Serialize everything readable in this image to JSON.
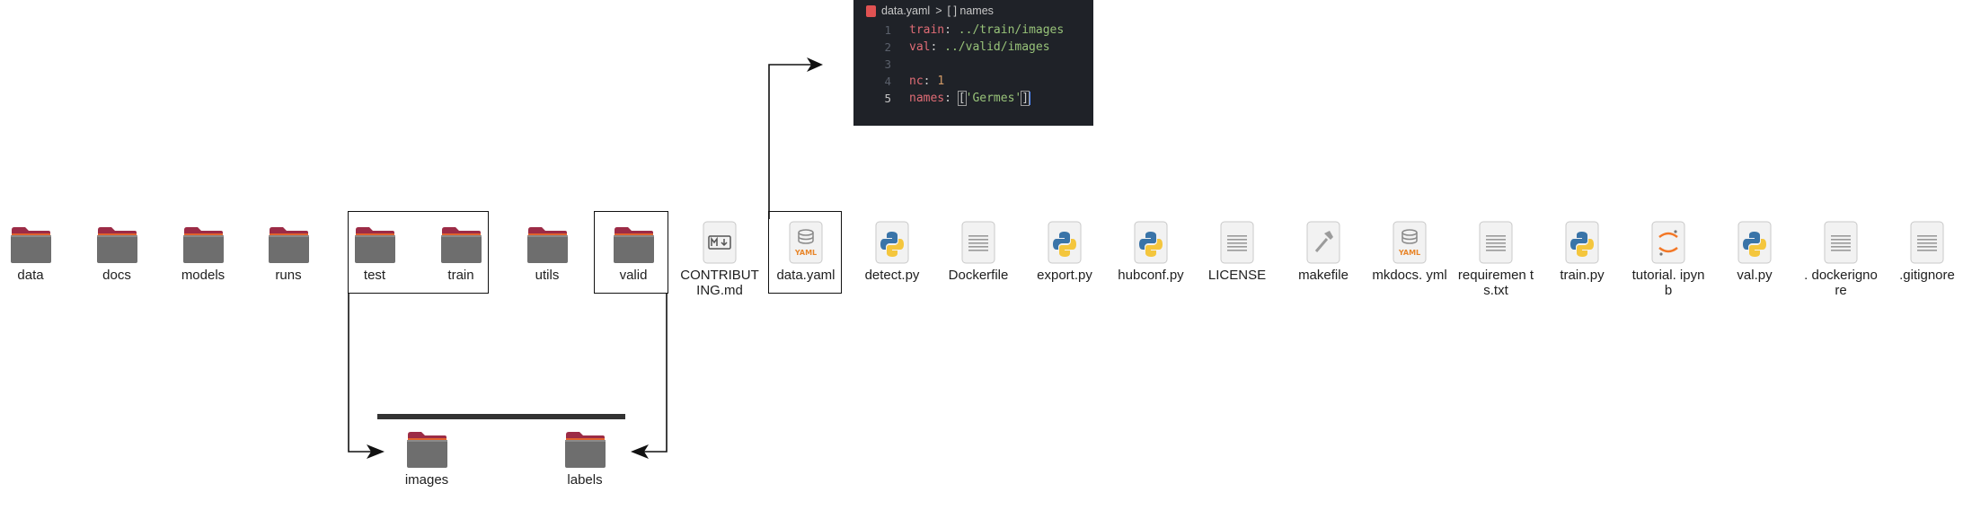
{
  "root_items": [
    {
      "label": "data",
      "icon": "folder-icon"
    },
    {
      "label": "docs",
      "icon": "folder-icon"
    },
    {
      "label": "models",
      "icon": "folder-icon"
    },
    {
      "label": "runs",
      "icon": "folder-icon"
    },
    {
      "label": "test",
      "icon": "folder-icon"
    },
    {
      "label": "train",
      "icon": "folder-icon"
    },
    {
      "label": "utils",
      "icon": "folder-icon"
    },
    {
      "label": "valid",
      "icon": "folder-icon"
    },
    {
      "label": "CONTRIBUT ING.md",
      "icon": "markdown-file-icon"
    },
    {
      "label": "data.yaml",
      "icon": "yaml-file-icon"
    },
    {
      "label": "detect.py",
      "icon": "python-file-icon"
    },
    {
      "label": "Dockerfile",
      "icon": "text-file-icon"
    },
    {
      "label": "export.py",
      "icon": "python-file-icon"
    },
    {
      "label": "hubconf.py",
      "icon": "python-file-icon"
    },
    {
      "label": "LICENSE",
      "icon": "text-file-icon"
    },
    {
      "label": "makefile",
      "icon": "makefile-icon"
    },
    {
      "label": "mkdocs. yml",
      "icon": "yaml-file-icon"
    },
    {
      "label": "requiremen ts.txt",
      "icon": "text-file-icon"
    },
    {
      "label": "train.py",
      "icon": "python-file-icon"
    },
    {
      "label": "tutorial. ipynb",
      "icon": "jupyter-file-icon"
    },
    {
      "label": "val.py",
      "icon": "python-file-icon"
    },
    {
      "label": ". dockerigno re",
      "icon": "text-file-icon"
    },
    {
      "label": ".gitignore",
      "icon": "text-file-icon"
    }
  ],
  "sub_items": [
    {
      "label": "images",
      "icon": "folder-icon"
    },
    {
      "label": "labels",
      "icon": "folder-icon"
    }
  ],
  "editor": {
    "breadcrumb_file": "data.yaml",
    "breadcrumb_sep": ">",
    "breadcrumb_symbol": "[ ] names",
    "lines": [
      {
        "num": "1",
        "key": "train",
        "sep": ": ",
        "value": "../train/images"
      },
      {
        "num": "2",
        "key": "val",
        "sep": ": ",
        "value": "../valid/images"
      },
      {
        "num": "3",
        "key": "",
        "sep": "",
        "value": ""
      },
      {
        "num": "4",
        "key": "nc",
        "sep": ": ",
        "value": "1"
      },
      {
        "num": "5",
        "key": "names",
        "sep": ": ",
        "open": "[",
        "value": "'Germes'",
        "close": "]"
      }
    ]
  },
  "colors": {
    "folder_body": "#6d6d6d",
    "folder_tab": "#b0303e",
    "folder_accent": "#e0622d",
    "editor_bg": "#1f2228",
    "keyword": "#e06c75",
    "string": "#98c379",
    "number": "#d19a66"
  }
}
